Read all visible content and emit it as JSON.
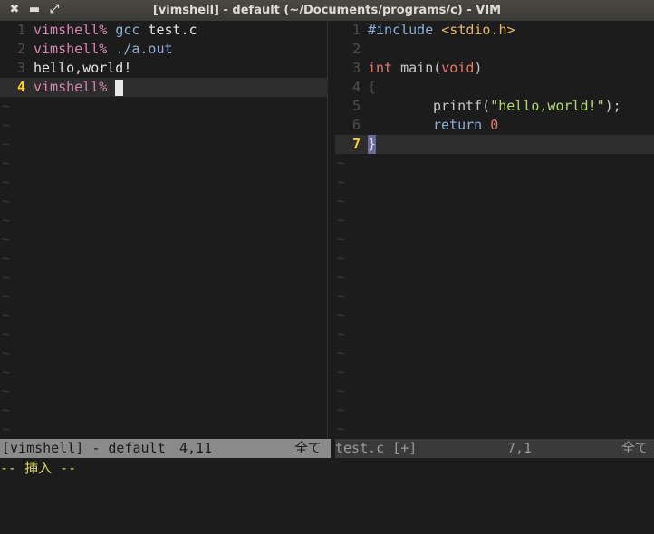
{
  "window": {
    "title": "[vimshell] - default (~/Documents/programs/c) - VIM",
    "controls": {
      "close": "✖",
      "minimize": "▬",
      "maximize": "⤢"
    }
  },
  "left_pane": {
    "lines": [
      {
        "num": "1",
        "prompt": "vimshell%",
        "cmd": "gcc",
        "args": " test.c"
      },
      {
        "num": "2",
        "prompt": "vimshell%",
        "cmd": "./a.out",
        "args": ""
      },
      {
        "num": "3",
        "text": "hello,world!"
      },
      {
        "num": "4",
        "prompt": "vimshell%"
      }
    ]
  },
  "right_pane": {
    "lines": [
      {
        "num": "1",
        "pre": "#include",
        "inc": "<stdio.h>"
      },
      {
        "num": "2"
      },
      {
        "num": "3",
        "type": "int",
        "func": " main(",
        "ptype": "void",
        "close": ")"
      },
      {
        "num": "4",
        "brace": "{"
      },
      {
        "num": "5",
        "func": "printf(",
        "str": "\"hello,world!\"",
        "end": ");"
      },
      {
        "num": "6",
        "kw": "return",
        "numval": "0"
      },
      {
        "num": "7",
        "brace": "}"
      }
    ]
  },
  "status": {
    "left_buffer": "[vimshell] - default",
    "left_pos": "4,11",
    "left_scroll": "全て",
    "right_buffer": "test.c [+]",
    "right_pos": "7,1",
    "right_scroll": "全て"
  },
  "cmdline": "-- 挿入 --",
  "tilde": "~"
}
